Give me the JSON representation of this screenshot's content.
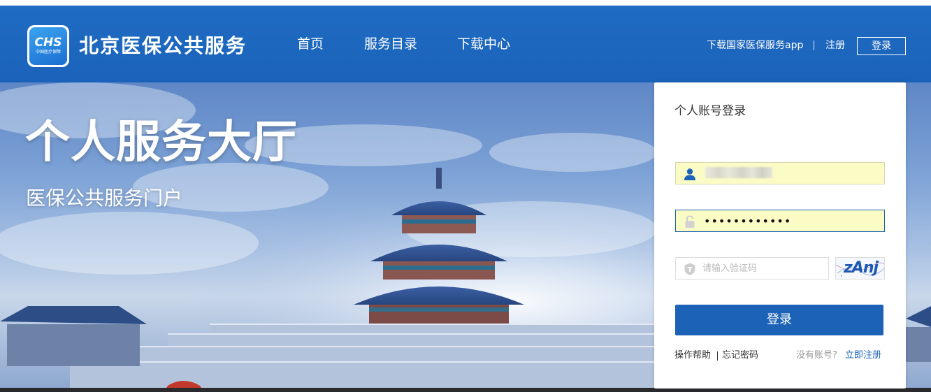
{
  "header": {
    "logo_text": "CHS",
    "logo_subtext": "中国医疗保障",
    "brand_title": "北京医保公共服务",
    "nav": [
      {
        "label": "首页"
      },
      {
        "label": "服务目录"
      },
      {
        "label": "下载中心"
      }
    ],
    "app_link": "下载国家医保服务app",
    "register_label": "注册",
    "login_label": "登录"
  },
  "hero": {
    "title": "个人服务大厅",
    "subtitle": "医保公共服务门户"
  },
  "login_panel": {
    "title": "个人账号登录",
    "username_value": "",
    "password_value": "••••••••••••",
    "captcha_placeholder": "请输入验证码",
    "captcha_text": "zAnj",
    "submit_label": "登录",
    "help_label": "操作帮助",
    "forgot_label": "忘记密码",
    "no_account_label": "没有账号?",
    "signup_label": "立即注册"
  },
  "colors": {
    "brand_blue": "#1c63b7",
    "header_blue": "#1f6bc3",
    "autofill_yellow": "#fbfcc5"
  }
}
